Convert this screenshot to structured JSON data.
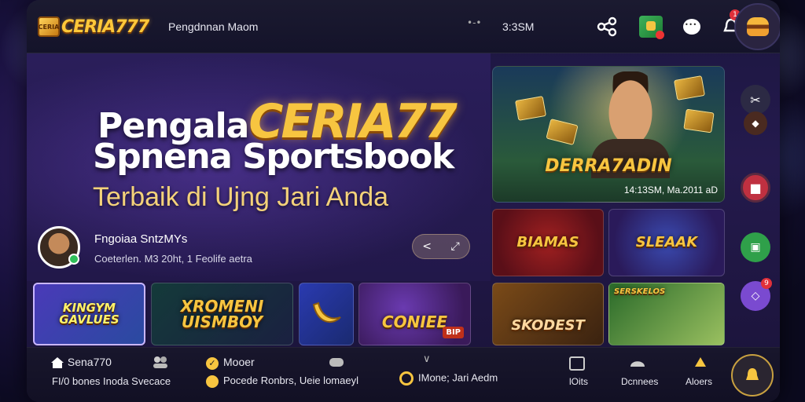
{
  "app": {
    "logo_text": "CERIA777",
    "logo_badge": "CERIA",
    "title": "Pengdnnan Maom",
    "dots": "•-•",
    "time": "3:3SM"
  },
  "header_icons": {
    "share": "share-icon",
    "gift": "gift-icon",
    "chat": "chat-icon",
    "notifications": "bell-icon",
    "notif_count": "1",
    "profile": "profile-avatar"
  },
  "hero": {
    "line1_part1": "Pengala",
    "line1_part2": "CERIA77",
    "line2": "Spnena Sportsbook",
    "line3": "Terbaik di Ujng Jari Anda",
    "user_name": "Fngoiaa SntzMYs",
    "user_sub": "Coeterlen. M3 20ht, 1 Feolife aetra",
    "pill_left": "<",
    "pill_right": "⤢"
  },
  "featured": {
    "title": "DERRA7ADIN",
    "subtitle": "14:13SM, Ma.2011 aD"
  },
  "tiles": [
    {
      "label": "KINGYM GAVLUES"
    },
    {
      "label": "XROMENI UISMBOY"
    },
    {
      "label": ""
    },
    {
      "label": "CONIEE",
      "badge": "BIP"
    },
    {
      "label": "BIAMAS"
    },
    {
      "label": "SLEAAK"
    },
    {
      "label": "SKODEST"
    },
    {
      "label": "SERSKELOS"
    }
  ],
  "side_dock": {
    "badge_count": "9"
  },
  "bottom_nav": {
    "home_title": "Sena770",
    "home_sub": "FI/0 bones Inoda Svecace",
    "mid1_title": "Mooer",
    "mid1_sub": "Pocede Ronbrs, Ueie lomaeyl",
    "mid2_sub": "IMone; Jari Aedm",
    "chevron": "∨",
    "item_a": "lOits",
    "item_b": "Dcnnees",
    "item_c": "Aloers"
  },
  "colors": {
    "gold": "#f7c540",
    "panel": "#241a4d",
    "green": "#2fbf5a",
    "red": "#e0303a"
  }
}
